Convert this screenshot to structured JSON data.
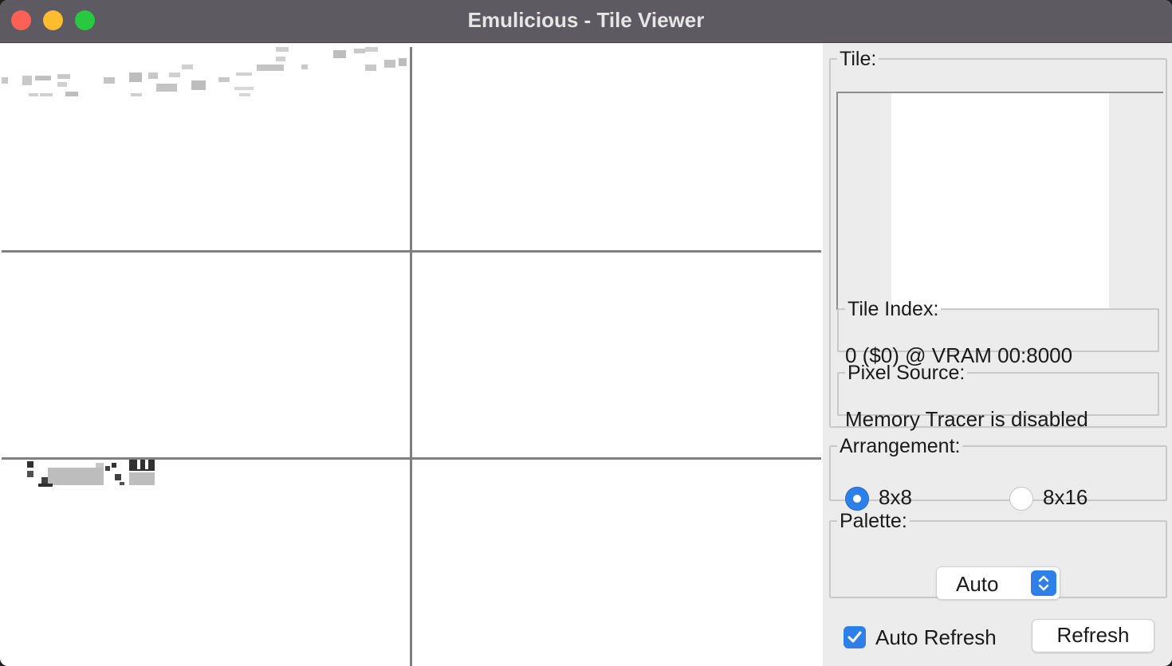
{
  "window": {
    "title": "Emulicious - Tile Viewer"
  },
  "tile": {
    "legend": "Tile:"
  },
  "tile_index": {
    "legend": "Tile Index:",
    "value": "0 ($0) @ VRAM 00:8000"
  },
  "pixel_source": {
    "legend": "Pixel Source:",
    "value": "Memory Tracer is disabled"
  },
  "arrangement": {
    "legend": "Arrangement:",
    "options": [
      {
        "label": "8x8",
        "selected": true
      },
      {
        "label": "8x16",
        "selected": false
      }
    ]
  },
  "palette": {
    "legend": "Palette:",
    "value": "Auto"
  },
  "auto_refresh": {
    "label": "Auto Refresh",
    "checked": true
  },
  "refresh_button": {
    "label": "Refresh"
  },
  "colors": {
    "accent": "#2f7fe8",
    "grid": "#808080",
    "titlebar": "#5d5b61"
  }
}
